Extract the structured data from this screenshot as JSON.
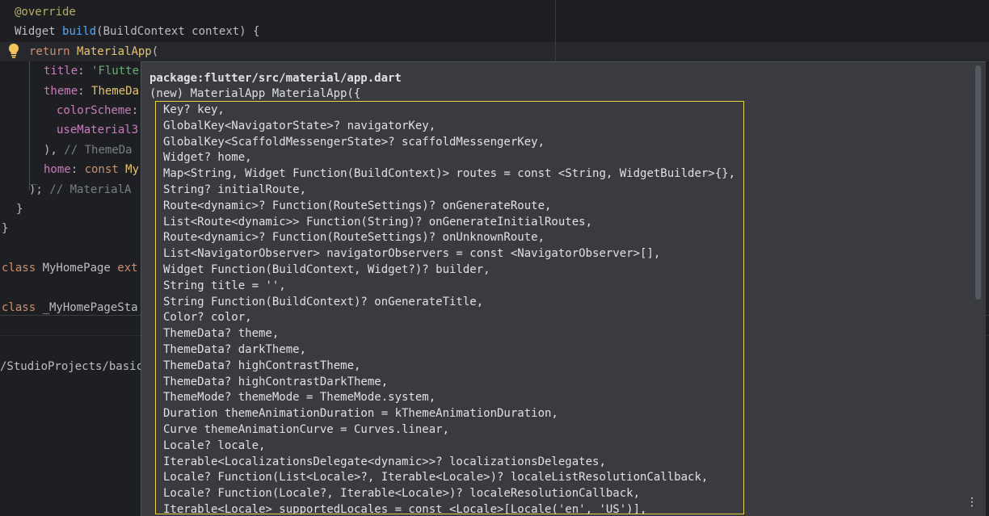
{
  "editor": {
    "lines": [
      {
        "parts": [
          [
            "ann",
            "@override"
          ]
        ]
      },
      {
        "parts": [
          [
            "plain",
            "Widget "
          ],
          [
            "fn",
            "build"
          ],
          [
            "plain",
            "(BuildContext context) {"
          ]
        ]
      },
      {
        "parts": [
          [
            "kw",
            "return "
          ],
          [
            "cls",
            "MaterialApp"
          ],
          [
            "plain",
            "("
          ]
        ]
      },
      {
        "parts": [
          [
            "prop",
            "title"
          ],
          [
            "plain",
            ": "
          ],
          [
            "str",
            "'Flutte"
          ]
        ]
      },
      {
        "parts": [
          [
            "prop",
            "theme"
          ],
          [
            "plain",
            ": "
          ],
          [
            "cls",
            "ThemeDa"
          ]
        ]
      },
      {
        "parts": [
          [
            "prop",
            "colorScheme"
          ],
          [
            "plain",
            ":"
          ]
        ]
      },
      {
        "parts": [
          [
            "prop",
            "useMaterial3"
          ]
        ]
      },
      {
        "parts": [
          [
            "plain",
            "), "
          ],
          [
            "cmt",
            "// ThemeDa"
          ]
        ]
      },
      {
        "parts": [
          [
            "prop",
            "home"
          ],
          [
            "plain",
            ": "
          ],
          [
            "kw",
            "const "
          ],
          [
            "cls",
            "My"
          ]
        ]
      },
      {
        "parts": [
          [
            "plain",
            "); "
          ],
          [
            "cmt",
            "// MaterialA"
          ]
        ]
      },
      {
        "parts": [
          [
            "plain",
            "}"
          ]
        ]
      },
      {
        "parts": [
          [
            "plain",
            "}"
          ]
        ]
      },
      {
        "parts": []
      },
      {
        "parts": [
          [
            "kw",
            "class "
          ],
          [
            "plain",
            "MyHomePage "
          ],
          [
            "kw",
            "ext"
          ]
        ]
      },
      {
        "parts": []
      },
      {
        "parts": [
          [
            "kw",
            "class "
          ],
          [
            "plain",
            "_MyHomePageSta"
          ]
        ]
      }
    ],
    "path_text": "/StudioProjects/basic"
  },
  "popup": {
    "package": "package:flutter/src/material/app.dart",
    "constructor": "(new) MaterialApp MaterialApp({",
    "params": [
      "Key? key,",
      "GlobalKey<NavigatorState>? navigatorKey,",
      "GlobalKey<ScaffoldMessengerState>? scaffoldMessengerKey,",
      "Widget? home,",
      "Map<String, Widget Function(BuildContext)> routes = const <String, WidgetBuilder>{},",
      "String? initialRoute,",
      "Route<dynamic>? Function(RouteSettings)? onGenerateRoute,",
      "List<Route<dynamic>> Function(String)? onGenerateInitialRoutes,",
      "Route<dynamic>? Function(RouteSettings)? onUnknownRoute,",
      "List<NavigatorObserver> navigatorObservers = const <NavigatorObserver>[],",
      "Widget Function(BuildContext, Widget?)? builder,",
      "String title = '',",
      "String Function(BuildContext)? onGenerateTitle,",
      "Color? color,",
      "ThemeData? theme,",
      "ThemeData? darkTheme,",
      "ThemeData? highContrastTheme,",
      "ThemeData? highContrastDarkTheme,",
      "ThemeMode? themeMode = ThemeMode.system,",
      "Duration themeAnimationDuration = kThemeAnimationDuration,",
      "Curve themeAnimationCurve = Curves.linear,",
      "Locale? locale,",
      "Iterable<LocalizationsDelegate<dynamic>>? localizationsDelegates,",
      "Locale? Function(List<Locale>?, Iterable<Locale>)? localeListResolutionCallback,",
      "Locale? Function(Locale?, Iterable<Locale>)? localeResolutionCallback,",
      "Iterable<Locale> supportedLocales = const <Locale>[Locale('en', 'US')],"
    ]
  },
  "icons": {
    "gutter": "lightbulb-icon",
    "menu": "more-vertical-icon"
  },
  "colors": {
    "highlight_border": "#e8d23a",
    "popup_bg": "#393b40",
    "editor_bg": "#1e1f22"
  }
}
